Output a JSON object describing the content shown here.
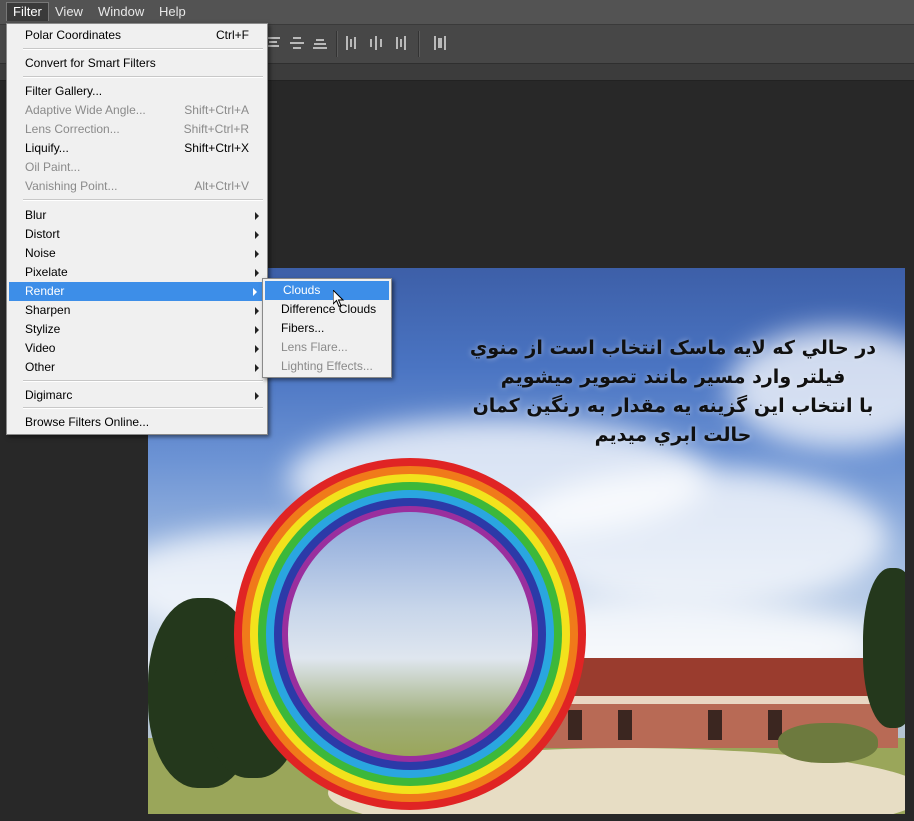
{
  "menubar": {
    "items": [
      "Filter",
      "View",
      "Window",
      "Help"
    ]
  },
  "filter_menu": {
    "items": [
      {
        "label": "Polar Coordinates",
        "shortcut": "Ctrl+F"
      },
      {
        "label": "Convert for Smart Filters",
        "shortcut": ""
      },
      {
        "label": "Filter Gallery...",
        "shortcut": ""
      },
      {
        "label": "Adaptive Wide Angle...",
        "shortcut": "Shift+Ctrl+A"
      },
      {
        "label": "Lens Correction...",
        "shortcut": "Shift+Ctrl+R"
      },
      {
        "label": "Liquify...",
        "shortcut": "Shift+Ctrl+X"
      },
      {
        "label": "Oil Paint...",
        "shortcut": ""
      },
      {
        "label": "Vanishing Point...",
        "shortcut": "Alt+Ctrl+V"
      },
      {
        "label": "Blur"
      },
      {
        "label": "Distort"
      },
      {
        "label": "Noise"
      },
      {
        "label": "Pixelate"
      },
      {
        "label": "Render"
      },
      {
        "label": "Sharpen"
      },
      {
        "label": "Stylize"
      },
      {
        "label": "Video"
      },
      {
        "label": "Other"
      },
      {
        "label": "Digimarc"
      },
      {
        "label": "Browse Filters Online..."
      }
    ]
  },
  "render_menu": {
    "items": [
      "Clouds",
      "Difference Clouds",
      "Fibers...",
      "Lens Flare...",
      "Lighting Effects..."
    ]
  },
  "canvas_text": {
    "lines": [
      "در حالي كه لايه ماسک انتخاب است از منوي",
      "فيلتر وارد مسير مانند تصوير ميشويم",
      "با انتخاب اين گزينه يه مقدار به رنگين كمان",
      "حالت ابري ميديم"
    ]
  },
  "colors": {
    "menu_highlight": "#3d8ee8",
    "menubar_bg": "#535353",
    "workspace_bg": "#282828"
  }
}
